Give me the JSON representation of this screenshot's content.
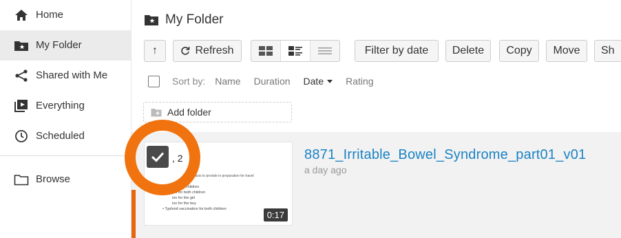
{
  "sidebar": {
    "items": [
      {
        "label": "Home",
        "icon": "home-icon"
      },
      {
        "label": "My Folder",
        "icon": "folder-star-icon",
        "active": true
      },
      {
        "label": "Shared with Me",
        "icon": "share-icon"
      },
      {
        "label": "Everything",
        "icon": "play-library-icon"
      },
      {
        "label": "Scheduled",
        "icon": "clock-icon"
      },
      {
        "label": "Browse",
        "icon": "folder-icon"
      }
    ]
  },
  "header": {
    "title": "My Folder"
  },
  "toolbar": {
    "up_label": "↑",
    "refresh_label": "Refresh",
    "filter_label": "Filter by date",
    "delete_label": "Delete",
    "copy_label": "Copy",
    "move_label": "Move",
    "share_label": "Sh"
  },
  "sort": {
    "label": "Sort by:",
    "options": [
      "Name",
      "Duration",
      "Date",
      "Rating"
    ],
    "active": "Date"
  },
  "add_folder_label": "Add folder",
  "session": {
    "title": "8871_Irritable_Bowel_Syndrome_part01_v01",
    "date": "a day ago",
    "duration": "0:17",
    "thumb_prefix": ", 2",
    "thumb_head": "rophylaxis to provide in preparation for travel",
    "thumb_big": "• The M",
    "thumb_lines": [
      "children",
      "ion for both children",
      "ion for the girl",
      "ion for the boy",
      "• Typhoid vaccination for both children"
    ]
  },
  "colors": {
    "accent": "#e8660f",
    "link": "#1a82c4",
    "highlight_ring": "#f0730f"
  }
}
